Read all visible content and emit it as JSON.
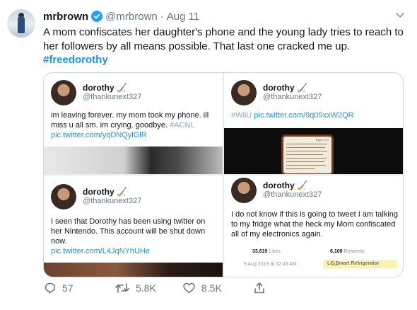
{
  "tweet": {
    "author_name": "mrbrown",
    "author_handle": "@mrbrown",
    "date": "Aug 11",
    "text": "A mom confiscates her daughter's phone and the young lady tries to reach to her followers by all means possible. That last one cracked me up.",
    "hashtag": "#freedorothy"
  },
  "media": [
    {
      "name": "dorothy 🏑",
      "handle": "@thankunext327",
      "text": "im leaving forever. my mom took my phone. ill miss u all sm. im crying. goodbye.",
      "tag": "#ACNL",
      "link": "pic.twitter.com/yqDNQylGlR"
    },
    {
      "name": "dorothy 🏑",
      "handle": "@thankunext327",
      "tag": "#WiiU",
      "link": "pic.twitter.com/9q09xxW2QR",
      "paper_header": "Page 1 of 1"
    },
    {
      "name": "dorothy 🏑",
      "handle": "@thankunext327",
      "text": "I seen that Dorothy has been using twitter on her Nintendo. This account will be shut down now.",
      "link": "pic.twitter.com/L4JqNYhUHe"
    },
    {
      "name": "dorothy 🏑",
      "handle": "@thankunext327",
      "text": "I do not know if this is going to tweet I am talking to my fridge what the heck my Mom confiscated all of my electronics again.",
      "likes_count": "33,619",
      "likes_label": "Likes",
      "retweets_count": "6,108",
      "retweets_label": "Retweets",
      "timestamp": "9 Aug 2019 at 12:43 AM",
      "via_prefix": "via",
      "via_app": "LG Smart Refrigerator"
    }
  ],
  "actions": {
    "replies": "57",
    "retweets": "5.8K",
    "likes": "8.5K"
  },
  "colors": {
    "accent": "#1da1f2",
    "link": "#1b95e0",
    "secondary_text": "#657786"
  },
  "icons": [
    "verified-badge-icon",
    "chevron-down-icon",
    "reply-icon",
    "retweet-icon",
    "like-icon",
    "share-icon"
  ]
}
